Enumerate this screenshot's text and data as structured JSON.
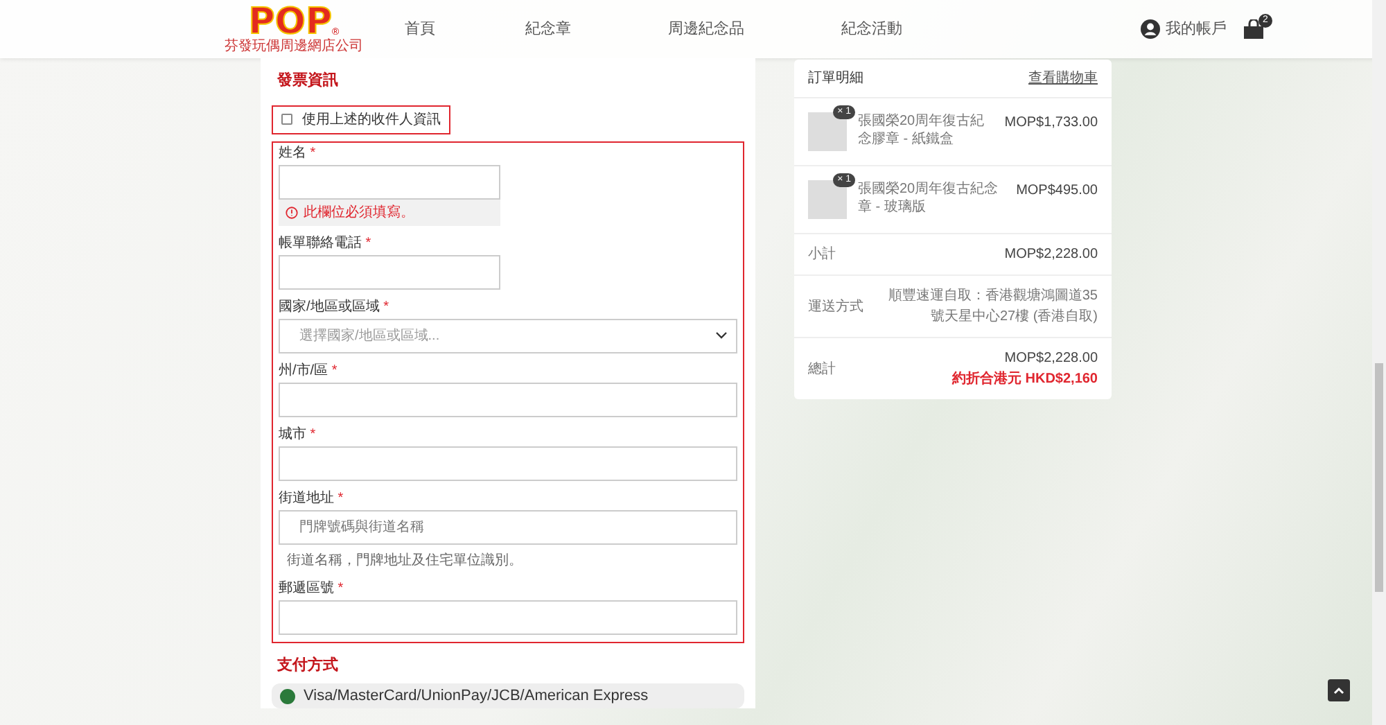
{
  "header": {
    "logo_text": "POP",
    "logo_mark": "®",
    "logo_caption": "芬發玩偶周邊網店公司",
    "nav": [
      {
        "label": "首頁",
        "selected": false
      },
      {
        "label": "紀念章",
        "selected": false
      },
      {
        "label": "周邊紀念品",
        "selected": false
      },
      {
        "label": "紀念活動",
        "selected": false
      }
    ],
    "account": "我的帳戶",
    "cart_count": "2"
  },
  "billing": {
    "title": "發票資訊",
    "use_shipping": {
      "label": "使用上述的收件人資訊",
      "checked": false
    },
    "fields": [
      {
        "kind": "short_input",
        "label": "姓名",
        "required": "*",
        "error": "此欄位必須填寫。"
      },
      {
        "kind": "short_input",
        "label": "帳單聯絡電話",
        "required": "*"
      },
      {
        "kind": "select",
        "label": "國家/地區或區域",
        "required": "*",
        "placeholder": "選擇國家/地區或區域..."
      },
      {
        "kind": "input",
        "label": "州/市/區",
        "required": "*"
      },
      {
        "kind": "input",
        "label": "城市",
        "required": "*"
      },
      {
        "kind": "input",
        "label": "街道地址",
        "required": "*",
        "placeholder": "門牌號碼與街道名稱",
        "help": "街道名稱，門牌地址及住宅單位識別。"
      },
      {
        "kind": "input",
        "label": "郵遞區號",
        "required": "*"
      }
    ]
  },
  "payment": {
    "title": "支付方式",
    "options": [
      {
        "label": "Visa/MasterCard/UnionPay/JCB/American Express",
        "selected": true
      }
    ]
  },
  "order": {
    "title": "訂單明細",
    "link": "查看購物車",
    "items": [
      {
        "name": "張國榮20周年復古紀念膠章 - 紙鐵盒",
        "qty": "× 1",
        "price": "MOP$1,733.00"
      },
      {
        "name": "張國榮20周年復古紀念章 - 玻璃版",
        "qty": "× 1",
        "price": "MOP$495.00"
      }
    ],
    "subtotal": {
      "label": "小計",
      "value": "MOP$2,228.00"
    },
    "shipping": {
      "label": "運送方式",
      "value": "順豐速運自取：香港觀塘鴻圖道35號天星中心27樓 (香港自取)"
    },
    "total": {
      "label": "總計",
      "value": "MOP$2,228.00",
      "note": "約折合港元 HKD$2,160"
    }
  }
}
